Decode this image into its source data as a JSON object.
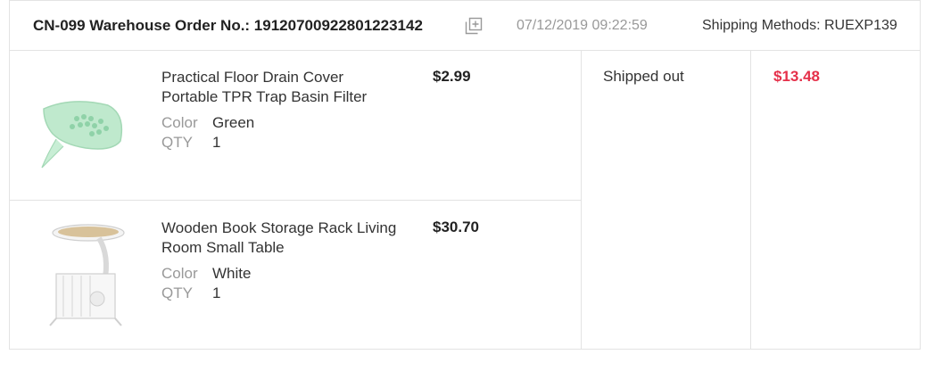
{
  "order": {
    "title": "CN-099 Warehouse Order No.: 1912070092280122314​2",
    "date": "07/12/2019 09:22:59",
    "shipping": "Shipping Methods: RUEXP139",
    "status": "Shipped out",
    "total": "$13.48"
  },
  "labels": {
    "color": "Color",
    "qty": "QTY"
  },
  "products": [
    {
      "name": "Practical Floor Drain Cover Portable TPR Trap Basin Filter",
      "price": "$2.99",
      "color": "Green",
      "qty": "1",
      "thumb_color": "#b8e8c9"
    },
    {
      "name": "Wooden Book Storage Rack Living Room Small Table",
      "price": "$30.70",
      "color": "White",
      "qty": "1",
      "thumb_color": "#d8c29a"
    }
  ],
  "icons": {
    "copy": "copy-icon"
  }
}
